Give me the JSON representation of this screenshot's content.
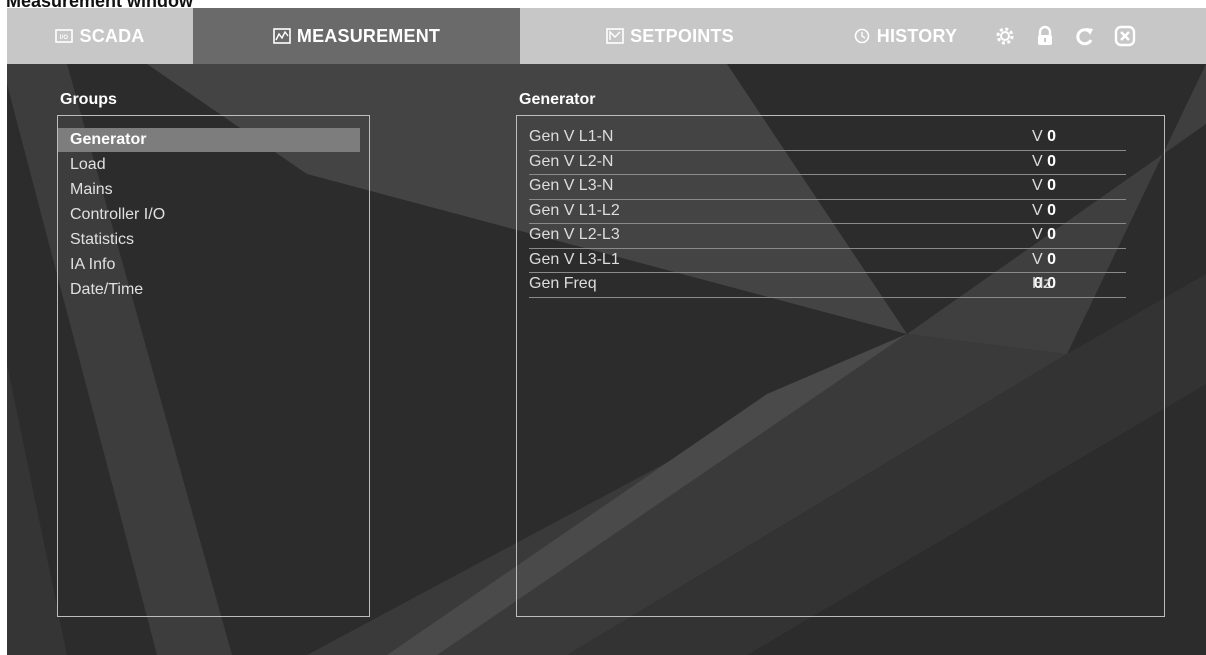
{
  "caption": "Measurement window",
  "tabs": [
    {
      "label": "SCADA",
      "icon": "scada-icon",
      "active": false
    },
    {
      "label": "MEASUREMENT",
      "icon": "measurement-icon",
      "active": true
    },
    {
      "label": "SETPOINTS",
      "icon": "setpoints-icon",
      "active": false
    },
    {
      "label": "HISTORY",
      "icon": "history-icon",
      "active": false
    }
  ],
  "toolbar_icons": [
    "gear-icon",
    "lock-icon",
    "refresh-icon",
    "close-icon"
  ],
  "groups": {
    "title": "Groups",
    "items": [
      "Generator",
      "Load",
      "Mains",
      "Controller I/O",
      "Statistics",
      "IA Info",
      "Date/Time"
    ],
    "selected": "Generator"
  },
  "values": {
    "title": "Generator",
    "rows": [
      {
        "label": "Gen V L1-N",
        "value": "0",
        "unit": "V"
      },
      {
        "label": "Gen V L2-N",
        "value": "0",
        "unit": "V"
      },
      {
        "label": "Gen V L3-N",
        "value": "0",
        "unit": "V"
      },
      {
        "label": "Gen V L1-L2",
        "value": "0",
        "unit": "V"
      },
      {
        "label": "Gen V L2-L3",
        "value": "0",
        "unit": "V"
      },
      {
        "label": "Gen V L3-L1",
        "value": "0",
        "unit": "V"
      },
      {
        "label": "Gen Freq",
        "value": "0.0",
        "unit": "Hz"
      }
    ]
  },
  "colors": {
    "background": "#2c2c2c",
    "topbar": "#c7c7c7",
    "active_tab": "#6a6a6a",
    "selection": "#7d7d7d"
  }
}
